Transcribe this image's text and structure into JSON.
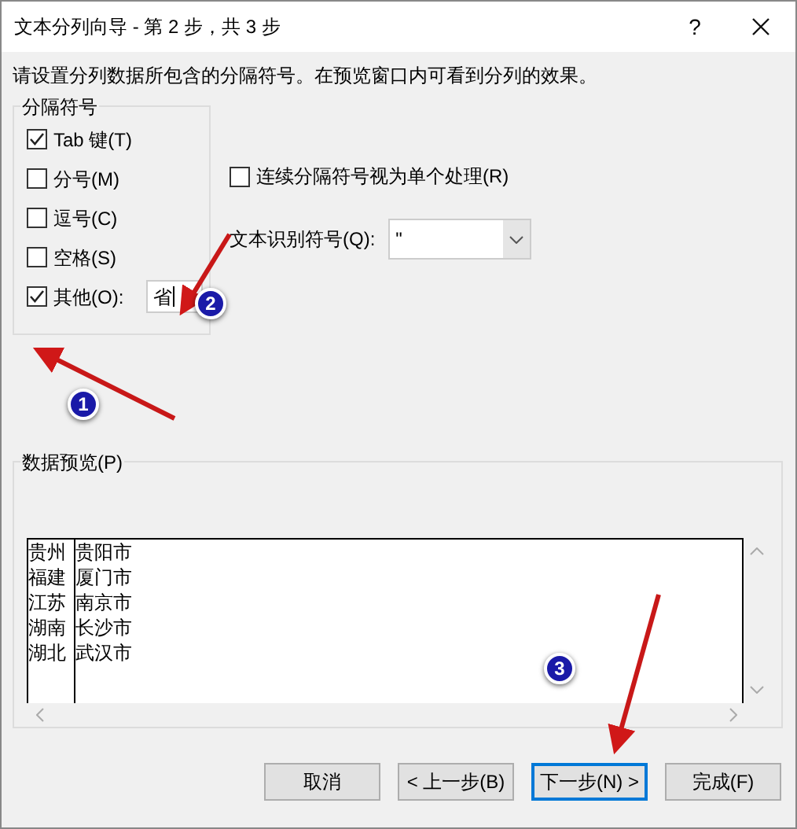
{
  "window": {
    "title": "文本分列向导 - 第 2 步，共 3 步",
    "help": "?"
  },
  "instruction": "请设置分列数据所包含的分隔符号。在预览窗口内可看到分列的效果。",
  "delimiters": {
    "title": "分隔符号",
    "items": [
      {
        "label": "Tab 键(T)",
        "checked": true
      },
      {
        "label": "分号(M)",
        "checked": false
      },
      {
        "label": "逗号(C)",
        "checked": false
      },
      {
        "label": "空格(S)",
        "checked": false
      },
      {
        "label": "其他(O):",
        "checked": true,
        "value": "省"
      }
    ]
  },
  "consecutive": {
    "label": "连续分隔符号视为单个处理(R)",
    "checked": false
  },
  "qualifier": {
    "label": "文本识别符号(Q):",
    "value": "\""
  },
  "preview": {
    "title": "数据预览(P)",
    "rows": [
      [
        "贵州",
        "贵阳市"
      ],
      [
        "福建",
        "厦门市"
      ],
      [
        "江苏",
        "南京市"
      ],
      [
        "湖南",
        "长沙市"
      ],
      [
        "湖北",
        "武汉市"
      ]
    ]
  },
  "buttons": [
    {
      "label": "取消",
      "selected": false
    },
    {
      "label": "< 上一步(B)",
      "selected": false
    },
    {
      "label": "下一步(N) >",
      "selected": true
    },
    {
      "label": "完成(F)",
      "selected": false
    }
  ],
  "annotations": [
    "1",
    "2",
    "3"
  ]
}
